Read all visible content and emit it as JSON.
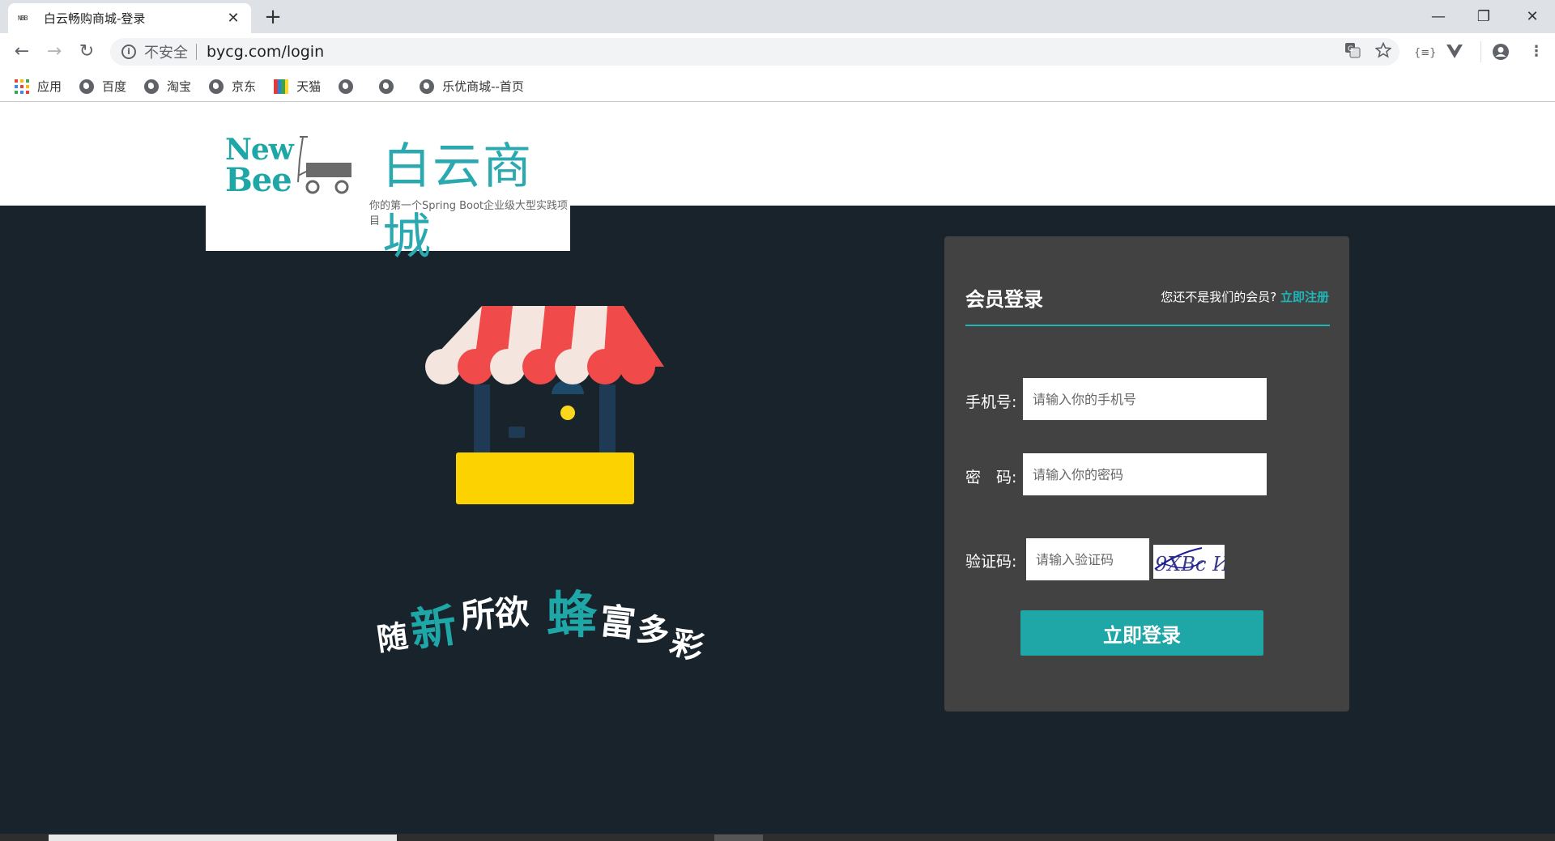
{
  "browser": {
    "tab_favicon": "NBB",
    "tab_title": "白云畅购商城-登录",
    "tab_close": "✕",
    "new_tab": "+",
    "window_minimize": "—",
    "window_restore": "❐",
    "window_close": "✕",
    "back": "←",
    "forward": "→",
    "reload": "↻",
    "security_label": "不安全",
    "url": "bycg.com/login",
    "translate_icon": "translate-icon",
    "star_icon": "star-icon"
  },
  "bookmarks": [
    {
      "label": "应用",
      "icon": "apps-icon"
    },
    {
      "label": "百度",
      "icon": "globe-icon"
    },
    {
      "label": "淘宝",
      "icon": "globe-icon"
    },
    {
      "label": "京东",
      "icon": "globe-icon"
    },
    {
      "label": "天猫",
      "icon": "tmall-icon"
    },
    {
      "label": "",
      "icon": "globe-icon"
    },
    {
      "label": "",
      "icon": "globe-icon"
    },
    {
      "label": "乐优商城--首页",
      "icon": "globe-icon"
    }
  ],
  "logo": {
    "new": "New",
    "bee": "Bee",
    "title": "白云商城",
    "subtitle": "你的第一个Spring Boot企业级大型实践项目"
  },
  "slogan": {
    "c1": "随",
    "c2": "新",
    "c3": "所欲",
    "c4": "蜂",
    "c5": "富",
    "c6": "多",
    "c7": "彩"
  },
  "login": {
    "heading": "会员登录",
    "register_prompt": "您还不是我们的会员?",
    "register_link": "立即注册",
    "phone_label": "手机号:",
    "phone_placeholder": "请输入你的手机号",
    "password_label": "密　码:",
    "password_placeholder": "请输入你的密码",
    "captcha_label": "验证码:",
    "captcha_placeholder": "请输入验证码",
    "captcha_text": "9XBc И",
    "submit_label": "立即登录"
  },
  "colors": {
    "brand_teal": "#1fa7a8",
    "hero_bg": "#18232c",
    "panel_bg": "#424242"
  }
}
